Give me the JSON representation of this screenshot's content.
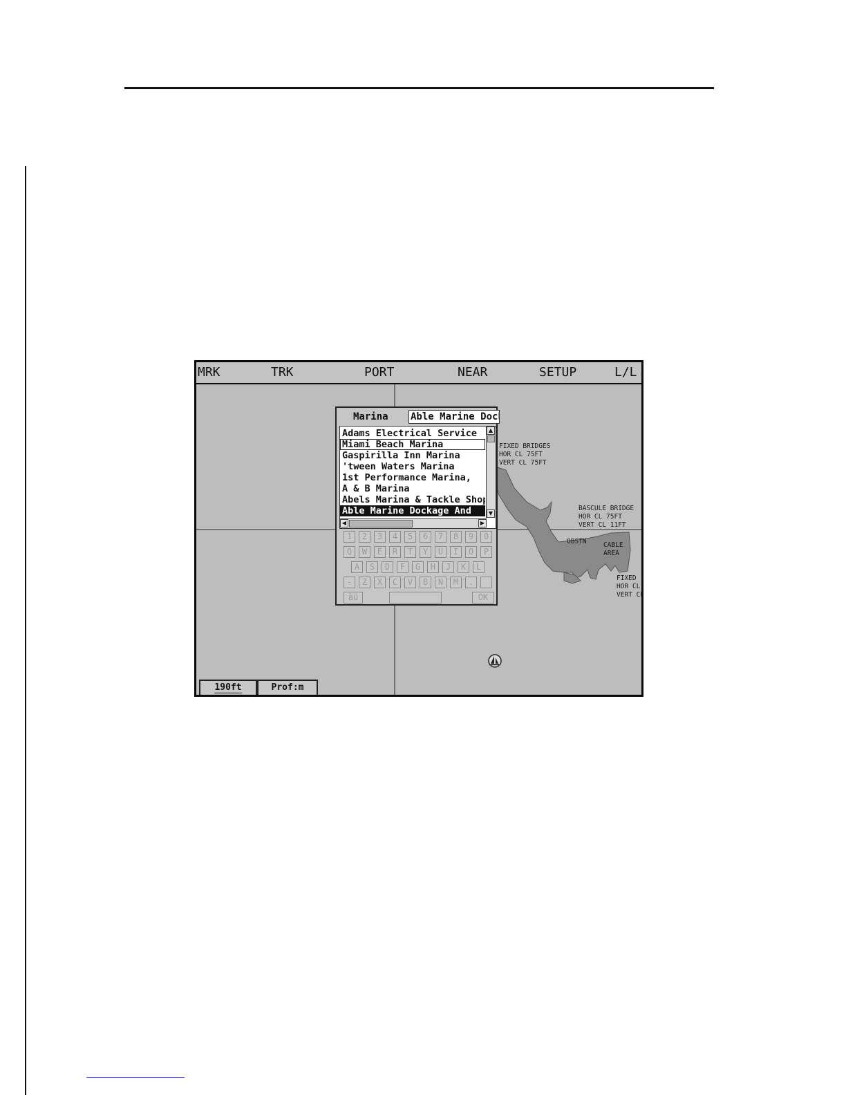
{
  "menu": [
    "MRK",
    "TRK",
    "PORT",
    "NEAR",
    "SETUP",
    "L/L"
  ],
  "dialog": {
    "label": "Marina",
    "input_value": "Able Marine Dockage And",
    "items": [
      "Adams Electrical Service",
      "Miami Beach Marina",
      " Gaspirilla Inn Marina",
      "'tween Waters Marina",
      "1st Performance Marina,",
      "A & B Marina",
      "Abels Marina & Tackle Shop",
      "Able Marine Dockage And"
    ],
    "selected_index": 7,
    "keyboard": {
      "row1": [
        "1",
        "2",
        "3",
        "4",
        "5",
        "6",
        "7",
        "8",
        "9",
        "0"
      ],
      "row2": [
        "Q",
        "W",
        "E",
        "R",
        "T",
        "Y",
        "U",
        "I",
        "O",
        "P"
      ],
      "row3": [
        "A",
        "S",
        "D",
        "F",
        "G",
        "H",
        "J",
        "K",
        "L"
      ],
      "row4": [
        "-",
        "Z",
        "X",
        "C",
        "V",
        "B",
        "N",
        "M",
        ".",
        ""
      ],
      "accent_key": "àü",
      "space_key": "",
      "ok_key": "OK"
    }
  },
  "map_labels": {
    "fixed_bridges": "FIXED BRIDGES\nHOR CL 75FT\nVERT CL 75FT",
    "bascule_bridge": "BASCULE BRIDGE\nHOR CL 75FT\nVERT CL 11FT",
    "obstn": "OBSTN",
    "cable_area": "CABLE\nAREA",
    "fixed_partial": "FIXED\nHOR CL\nVERT CL"
  },
  "status": {
    "scale": "190ft",
    "profile": "Prof:m"
  },
  "icons": {
    "vessel": "sailboat-icon",
    "scroll_up": "arrow-up-icon",
    "scroll_down": "arrow-down-icon",
    "scroll_left": "arrow-left-icon",
    "scroll_right": "arrow-right-icon"
  },
  "colors": {
    "chart_background": "#bdbdbd",
    "land": "#8a8a8a",
    "selection": "#111111"
  }
}
